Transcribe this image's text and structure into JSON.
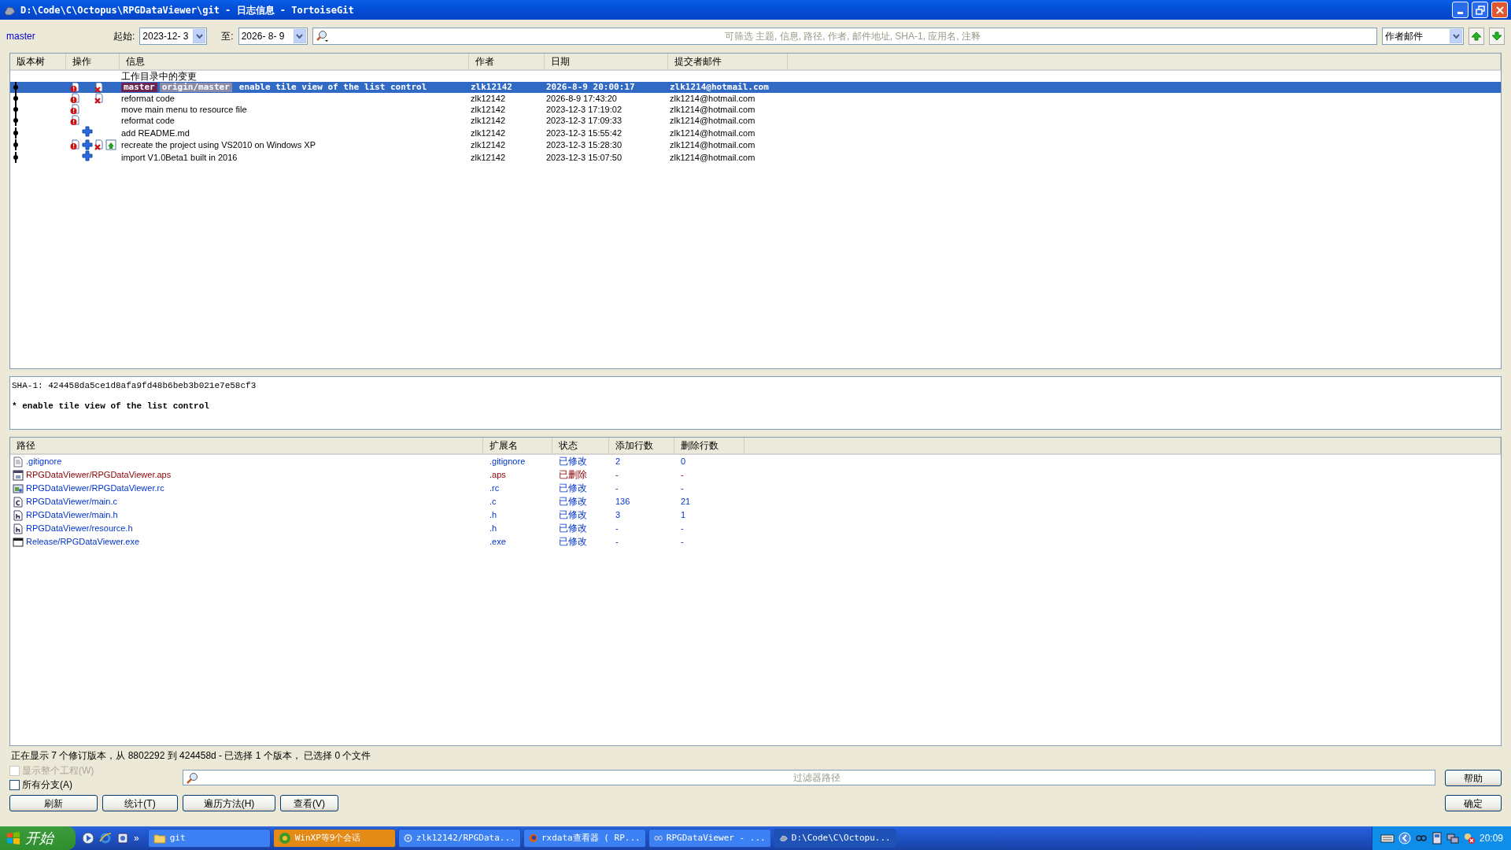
{
  "window": {
    "title": "D:\\Code\\C\\Octopus\\RPGDataViewer\\git - 日志信息 - TortoiseGit"
  },
  "toolbar": {
    "branch": "master",
    "from_label": "起始:",
    "from_value": "2023-12- 3",
    "to_label": "至:",
    "to_value": "2026- 8- 9",
    "search_placeholder": "可筛选 主题, 信息, 路径, 作者, 邮件地址, SHA-1, 应用名, 注释",
    "filter_field": "作者邮件"
  },
  "log": {
    "columns": [
      "版本树",
      "操作",
      "信息",
      "作者",
      "日期",
      "提交者邮件"
    ],
    "rows": [
      {
        "kind": "workdir",
        "message": "工作目录中的变更",
        "selected": false
      },
      {
        "kind": "commit",
        "actions": [
          {
            "kind": "modified"
          },
          {
            "kind": "deleted"
          }
        ],
        "refs": [
          {
            "label": "master",
            "kind": "local"
          },
          {
            "label": "origin/master",
            "kind": "remote"
          }
        ],
        "message": "enable tile view of the list control",
        "author": "zlk12142",
        "date": "2026-8-9 20:00:17",
        "email": "zlk1214@hotmail.com",
        "selected": true
      },
      {
        "kind": "commit",
        "actions": [
          {
            "kind": "modified"
          },
          {
            "kind": "deleted"
          }
        ],
        "refs": [],
        "message": "reformat code",
        "author": "zlk12142",
        "date": "2026-8-9 17:43:20",
        "email": "zlk1214@hotmail.com",
        "selected": false
      },
      {
        "kind": "commit",
        "actions": [
          {
            "kind": "modified"
          }
        ],
        "refs": [],
        "message": "move main menu to resource file",
        "author": "zlk12142",
        "date": "2023-12-3 17:19:02",
        "email": "zlk1214@hotmail.com",
        "selected": false
      },
      {
        "kind": "commit",
        "actions": [
          {
            "kind": "modified"
          }
        ],
        "refs": [],
        "message": "reformat code",
        "author": "zlk12142",
        "date": "2023-12-3 17:09:33",
        "email": "zlk1214@hotmail.com",
        "selected": false
      },
      {
        "kind": "commit",
        "actions": [
          {
            "kind": "added"
          }
        ],
        "refs": [],
        "message": "add README.md",
        "author": "zlk12142",
        "date": "2023-12-3 15:55:42",
        "email": "zlk1214@hotmail.com",
        "selected": false
      },
      {
        "kind": "commit",
        "actions": [
          {
            "kind": "modified"
          },
          {
            "kind": "added"
          },
          {
            "kind": "deleted"
          },
          {
            "kind": "renamed"
          }
        ],
        "refs": [],
        "message": "recreate the project using VS2010 on Windows XP",
        "author": "zlk12142",
        "date": "2023-12-3 15:28:30",
        "email": "zlk1214@hotmail.com",
        "selected": false
      },
      {
        "kind": "commit",
        "actions": [
          {
            "kind": "added"
          }
        ],
        "refs": [],
        "message": "import V1.0Beta1 built in 2016",
        "author": "zlk12142",
        "date": "2023-12-3 15:07:50",
        "email": "zlk1214@hotmail.com",
        "selected": false
      }
    ]
  },
  "details": {
    "sha": "SHA-1: 424458da5ce1d8afa9fd48b6beb3b021e7e58cf3",
    "message": "* enable tile view of the list control"
  },
  "files": {
    "columns": [
      "路径",
      "扩展名",
      "状态",
      "添加行数",
      "删除行数"
    ],
    "rows": [
      {
        "kind": "text",
        "path": ".gitignore",
        "ext": ".gitignore",
        "status": "已修改",
        "added": "2",
        "deleted_lines": "0",
        "deleted": false
      },
      {
        "kind": "resource",
        "path": "RPGDataViewer/RPGDataViewer.aps",
        "ext": ".aps",
        "status": "已删除",
        "added": "-",
        "deleted_lines": "-",
        "deleted": true
      },
      {
        "kind": "rc",
        "path": "RPGDataViewer/RPGDataViewer.rc",
        "ext": ".rc",
        "status": "已修改",
        "added": "-",
        "deleted_lines": "-",
        "deleted": false
      },
      {
        "kind": "c",
        "path": "RPGDataViewer/main.c",
        "ext": ".c",
        "status": "已修改",
        "added": "136",
        "deleted_lines": "21",
        "deleted": false
      },
      {
        "kind": "h",
        "path": "RPGDataViewer/main.h",
        "ext": ".h",
        "status": "已修改",
        "added": "3",
        "deleted_lines": "1",
        "deleted": false
      },
      {
        "kind": "h",
        "path": "RPGDataViewer/resource.h",
        "ext": ".h",
        "status": "已修改",
        "added": "-",
        "deleted_lines": "-",
        "deleted": false
      },
      {
        "kind": "exe",
        "path": "Release/RPGDataViewer.exe",
        "ext": ".exe",
        "status": "已修改",
        "added": "-",
        "deleted_lines": "-",
        "deleted": false
      }
    ]
  },
  "status_bar": "正在显示 7 个修订版本，从 8802292 到 424458d - 已选择 1 个版本， 已选择 0 个文件",
  "options": [
    {
      "label": "显示整个工程(W)",
      "checked": false,
      "disabled": true
    },
    {
      "label": "所有分支(A)",
      "checked": false,
      "disabled": false
    }
  ],
  "path_filter_placeholder": "过滤器路径",
  "buttons": [
    "刷新",
    "统计(T)",
    "遍历方法(H)",
    "查看(V)"
  ],
  "right_buttons": [
    "帮助",
    "确定"
  ],
  "taskbar": {
    "start": "开始",
    "more": "»",
    "tasks": [
      {
        "label": "git",
        "kind": "folder",
        "selected": false
      },
      {
        "label": "WinXP等9个会话",
        "kind": "chat",
        "selected": false,
        "flashing": true
      },
      {
        "label": "zlk12142/RPGData...",
        "kind": "browser",
        "selected": false
      },
      {
        "label": "rxdata查看器 ( RP...",
        "kind": "firefox",
        "selected": false
      },
      {
        "label": "RPGDataViewer - ...",
        "kind": "studio",
        "selected": false
      },
      {
        "label": "D:\\Code\\C\\Octopu...",
        "kind": "tortoise",
        "selected": true
      }
    ],
    "clock": "20:09"
  }
}
